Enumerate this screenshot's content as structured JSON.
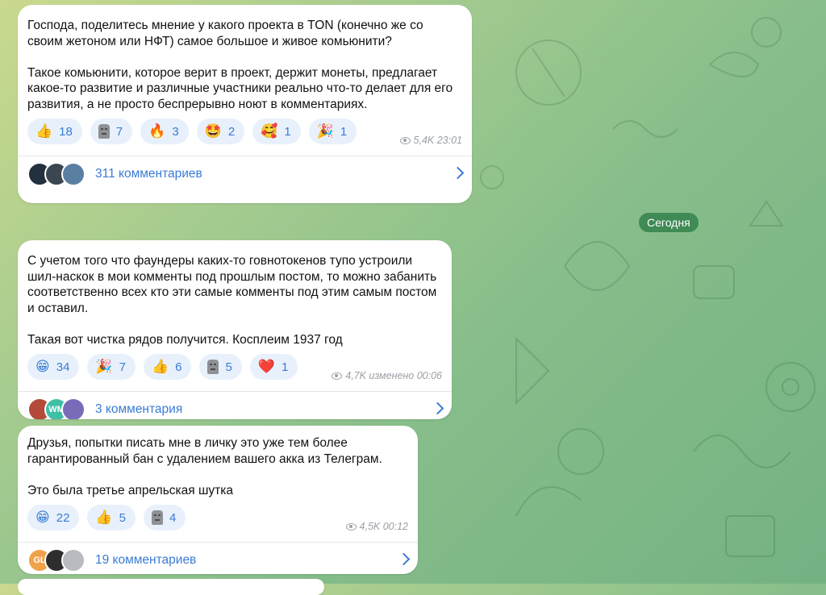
{
  "date_divider": "Сегодня",
  "posts": [
    {
      "text": "Господа, поделитесь мнение у какого проекта в TON (конечно же со своим жетоном или НФТ) самое большое и живое комьюнити?\n\nТакое комьюнити, которое верит в проект, держит монеты, предлагает какое-то развитие и различные участники реально что-то делает для его развития, а не просто беспрерывно ноют в комментариях.",
      "reactions": [
        {
          "emoji": "👍",
          "count": "18"
        },
        {
          "emoji": "moai-icon",
          "count": "7"
        },
        {
          "emoji": "🔥",
          "count": "3"
        },
        {
          "emoji": "🤩",
          "count": "2"
        },
        {
          "emoji": "🥰",
          "count": "1"
        },
        {
          "emoji": "🎉",
          "count": "1"
        }
      ],
      "views_time": "5,4K 23:01",
      "comments_label": "311 комментариев",
      "avatars": [
        {
          "text": "",
          "color": "#23303d"
        },
        {
          "text": "",
          "color": "#3c4650"
        },
        {
          "text": "",
          "color": "#5a7fa3"
        }
      ]
    },
    {
      "text": "С учетом того что фаундеры каких-то говнотокенов тупо устроили шил-наскок в мои комменты под прошлым постом, то можно забанить соответственно всех кто эти самые комменты под этим самым постом и оставил.\n\nТакая вот чистка рядов получится. Косплеим 1937 год",
      "reactions": [
        {
          "emoji": "😁",
          "count": "34"
        },
        {
          "emoji": "🎉",
          "count": "7"
        },
        {
          "emoji": "👍",
          "count": "6"
        },
        {
          "emoji": "moai-icon",
          "count": "5"
        },
        {
          "emoji": "❤️",
          "count": "1"
        }
      ],
      "views_time": "4,7K изменено 00:06",
      "comments_label": "3 комментария",
      "avatars": [
        {
          "text": "",
          "color": "#b34a3a"
        },
        {
          "text": "WM",
          "color": "#3fbfa5"
        },
        {
          "text": "",
          "color": "#7a6ab8"
        }
      ]
    },
    {
      "text": "Друзья, попытки писать мне в личку это уже тем более гарантированный бан с удалением вашего акка из Телеграм.\n\nЭто была третье апрельская шутка",
      "reactions": [
        {
          "emoji": "😁",
          "count": "22"
        },
        {
          "emoji": "👍",
          "count": "5"
        },
        {
          "emoji": "moai-icon",
          "count": "4"
        }
      ],
      "views_time": "4,5K 00:12",
      "comments_label": "19 комментариев",
      "avatars": [
        {
          "text": "GL",
          "color": "#f0a24a"
        },
        {
          "text": "",
          "color": "#2e2e2e"
        },
        {
          "text": "",
          "color": "#b8bcc0"
        }
      ]
    }
  ]
}
